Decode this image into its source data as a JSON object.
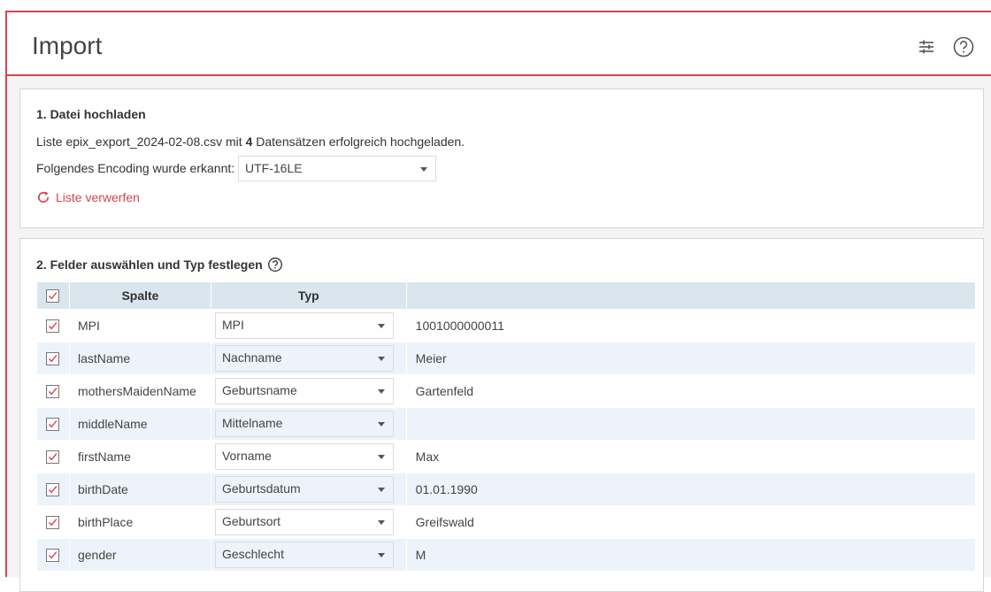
{
  "header": {
    "title": "Import"
  },
  "upload": {
    "title": "1. Datei hochladen",
    "msg_prefix": "Liste epix_export_2024-02-08.csv mit ",
    "count": "4",
    "msg_suffix": " Datensätzen erfolgreich hochgeladen.",
    "encoding_label": "Folgendes Encoding wurde erkannt:",
    "encoding_value": "UTF-16LE",
    "discard_label": "Liste verwerfen"
  },
  "fields": {
    "title": "2. Felder auswählen und Typ festlegen",
    "col_header": "Spalte",
    "type_header": "Typ",
    "rows": [
      {
        "column": "MPI",
        "type": "MPI",
        "preview": "1001000000011"
      },
      {
        "column": "lastName",
        "type": "Nachname",
        "preview": "Meier"
      },
      {
        "column": "mothersMaidenName",
        "type": "Geburtsname",
        "preview": "Gartenfeld"
      },
      {
        "column": "middleName",
        "type": "Mittelname",
        "preview": ""
      },
      {
        "column": "firstName",
        "type": "Vorname",
        "preview": "Max"
      },
      {
        "column": "birthDate",
        "type": "Geburtsdatum",
        "preview": "01.01.1990"
      },
      {
        "column": "birthPlace",
        "type": "Geburtsort",
        "preview": "Greifswald"
      },
      {
        "column": "gender",
        "type": "Geschlecht",
        "preview": "M"
      }
    ]
  },
  "colors": {
    "accent": "#d8434f",
    "table_header": "#d9e6ee",
    "row_alt": "#edf3fa"
  },
  "icons": {
    "settings": "sliders-icon",
    "help": "help-circle-icon",
    "discard": "refresh-icon"
  }
}
